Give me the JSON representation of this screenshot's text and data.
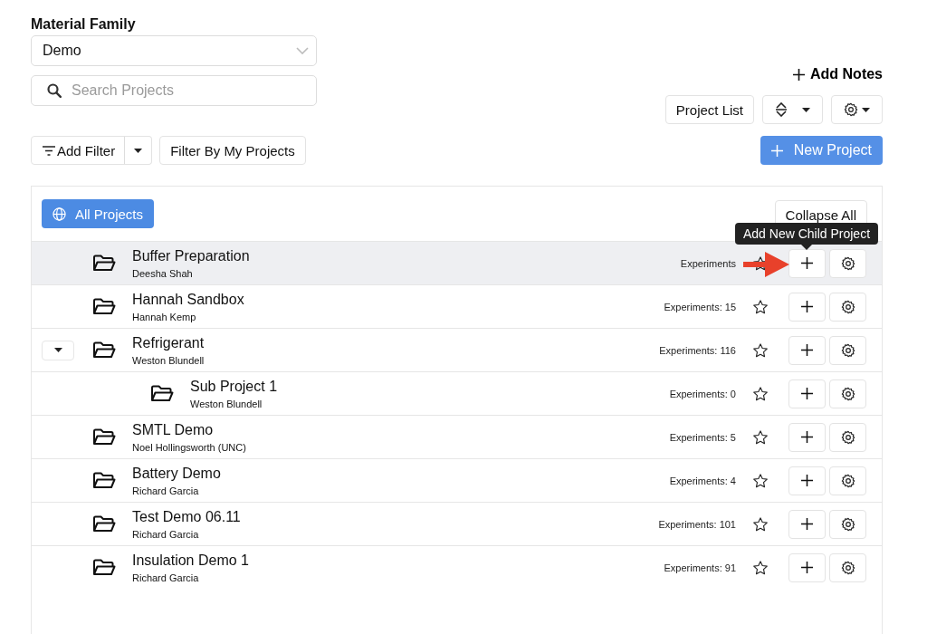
{
  "material_family": {
    "label": "Material Family",
    "value": "Demo"
  },
  "search": {
    "placeholder": "Search Projects"
  },
  "add_notes": "Add Notes",
  "view_button": "Project List",
  "filters": {
    "add_filter": "Add Filter",
    "my_projects": "Filter By My Projects"
  },
  "new_project": "New Project",
  "panel": {
    "all_projects": "All Projects",
    "collapse_all": "Collapse All"
  },
  "projects": [
    {
      "name": "Buffer Preparation",
      "owner": "Deesha Shah",
      "experiments": "Experiments",
      "starred": false,
      "highlighted": true,
      "tooltip": "Add New Child Project"
    },
    {
      "name": "Hannah Sandbox",
      "owner": "Hannah Kemp",
      "experiments": "Experiments: 15",
      "starred": false,
      "highlighted": false
    },
    {
      "name": "Refrigerant",
      "owner": "Weston Blundell",
      "experiments": "Experiments: 116",
      "starred": false,
      "highlighted": false,
      "expanded": true,
      "children": [
        {
          "name": "Sub Project 1",
          "owner": "Weston Blundell",
          "experiments": "Experiments: 0",
          "starred": false,
          "highlighted": false
        }
      ]
    },
    {
      "name": "SMTL Demo",
      "owner": "Noel Hollingsworth (UNC)",
      "experiments": "Experiments: 5",
      "starred": false,
      "highlighted": false
    },
    {
      "name": "Battery Demo",
      "owner": "Richard Garcia",
      "experiments": "Experiments: 4",
      "starred": false,
      "highlighted": false
    },
    {
      "name": "Test Demo 06.11",
      "owner": "Richard Garcia",
      "experiments": "Experiments: 101",
      "starred": false,
      "highlighted": false
    },
    {
      "name": "Insulation Demo 1",
      "owner": "Richard Garcia",
      "experiments": "Experiments: 91",
      "starred": false,
      "highlighted": false
    }
  ]
}
